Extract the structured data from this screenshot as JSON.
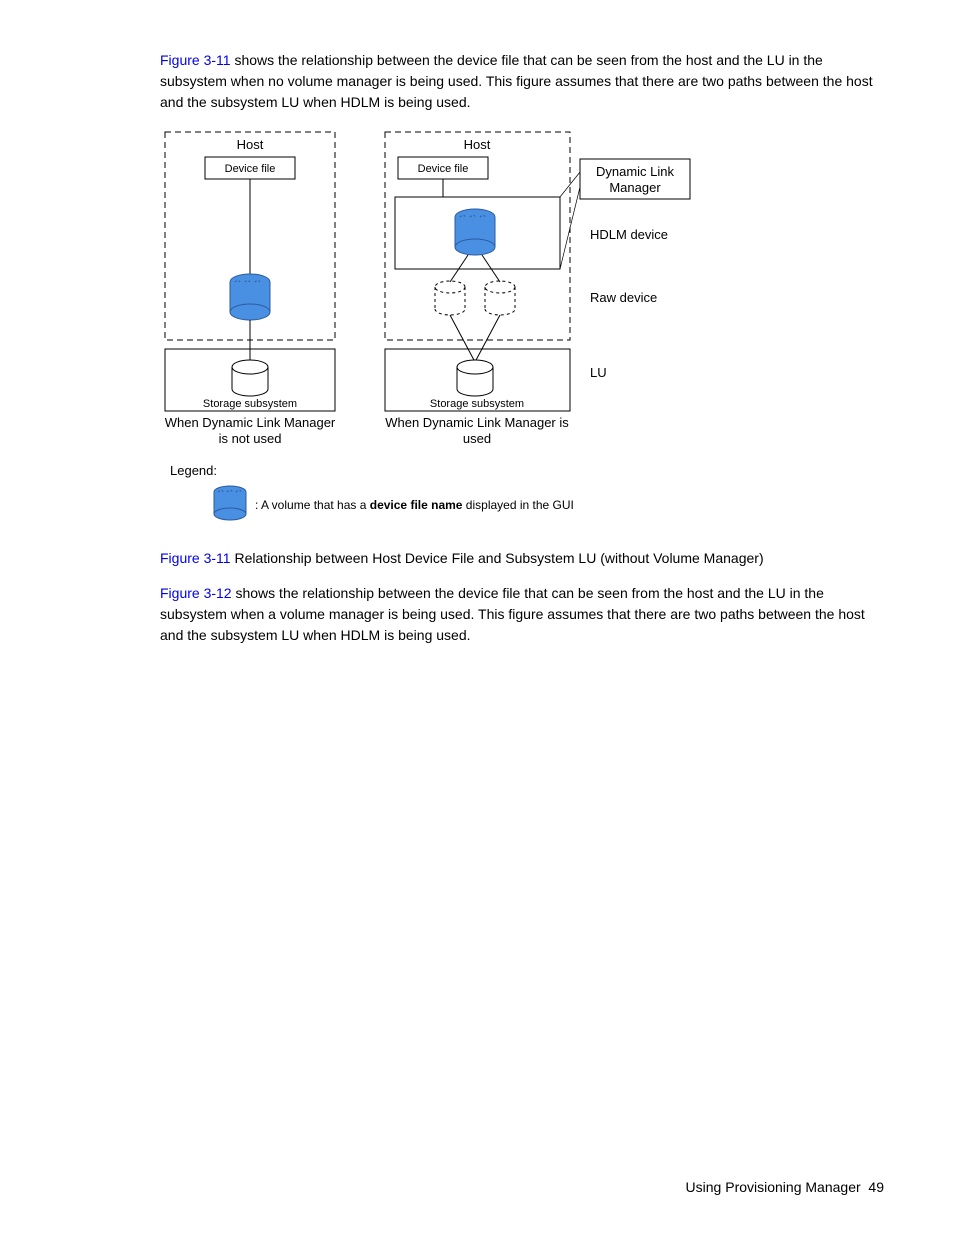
{
  "para1": {
    "ref": "Figure 3-11",
    "rest": " shows the relationship between the device file that can be seen from the host and the LU in the subsystem when no volume manager is being used. This figure assumes that there are two paths between the host and the subsystem LU when HDLM is being used."
  },
  "diagram": {
    "left": {
      "host": "Host",
      "devicefile": "Device file",
      "storage": "Storage subsystem",
      "caption1": "When Dynamic Link Manager",
      "caption2": "is not used"
    },
    "right": {
      "host": "Host",
      "devicefile": "Device file",
      "storage": "Storage subsystem",
      "caption1": "When Dynamic Link Manager is",
      "caption2": "used"
    },
    "labels": {
      "dlm1": "Dynamic Link",
      "dlm2": "Manager",
      "hdlm": "HDLM device",
      "raw": "Raw device",
      "lu": "LU"
    },
    "legend": {
      "title": "Legend:",
      "text1": ": A volume that has a ",
      "bold": "device file name",
      "text2": " displayed in the GUI"
    }
  },
  "caption11": {
    "ref": "Figure 3-11",
    "rest": " Relationship between Host Device File and Subsystem LU (without Volume Manager)"
  },
  "para2": {
    "ref": "Figure 3-12",
    "rest": " shows the relationship between the device file that can be seen from the host and the LU in the subsystem when a volume manager is being used. This figure assumes that there are two paths between the host and the subsystem LU when HDLM is being used."
  },
  "footer": {
    "title": "Using Provisioning Manager",
    "page": "49"
  }
}
